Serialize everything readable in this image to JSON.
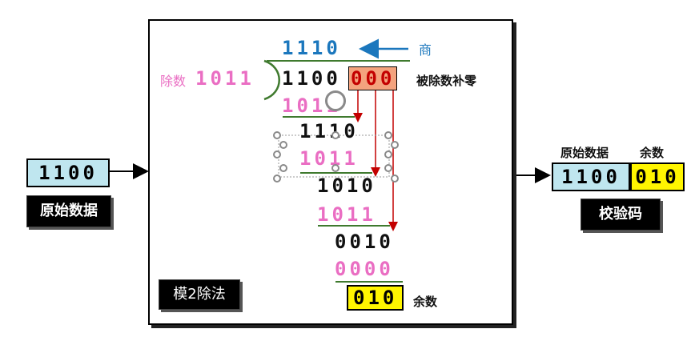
{
  "input": {
    "value": "1100",
    "label": "原始数据"
  },
  "process": {
    "label": "模2除法",
    "quotient": "1110",
    "quotient_label": "商",
    "divisor_label": "除数",
    "divisor": "1011",
    "dividend_head": "1100",
    "dividend_zeros": "000",
    "dividend_note": "被除数补零",
    "steps": [
      {
        "sub": "1011",
        "rem": "1110"
      },
      {
        "sub": "1011",
        "rem": "1010"
      },
      {
        "sub": "1011",
        "rem": "0010"
      },
      {
        "sub": "0000",
        "rem": "010"
      }
    ],
    "remainder_label": "余数"
  },
  "output": {
    "data_header": "原始数据",
    "rem_header": "余数",
    "data_value": "1100",
    "rem_value": "010",
    "label": "校验码"
  }
}
